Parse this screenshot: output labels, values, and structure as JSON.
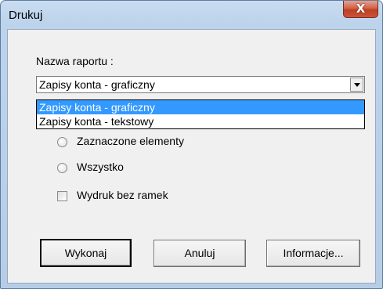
{
  "window": {
    "title": "Drukuj",
    "close_glyph": "X"
  },
  "report": {
    "label": "Nazwa raportu :",
    "selected_value": "Zapisy konta - graficzny",
    "options": [
      "Zapisy konta - graficzny",
      "Zapisy konta - tekstowy"
    ]
  },
  "scope": {
    "option_selected_label": "Zaznaczone elementy",
    "option_all_label": "Wszystko"
  },
  "no_border_print": {
    "label": "Wydruk bez ramek",
    "checked": false
  },
  "buttons": {
    "execute": "Wykonaj",
    "cancel": "Anuluj",
    "info": "Informacje..."
  },
  "colors": {
    "selection": "#3399ff",
    "close_button": "#c9543a",
    "title_bar": "#bcd3ec"
  }
}
